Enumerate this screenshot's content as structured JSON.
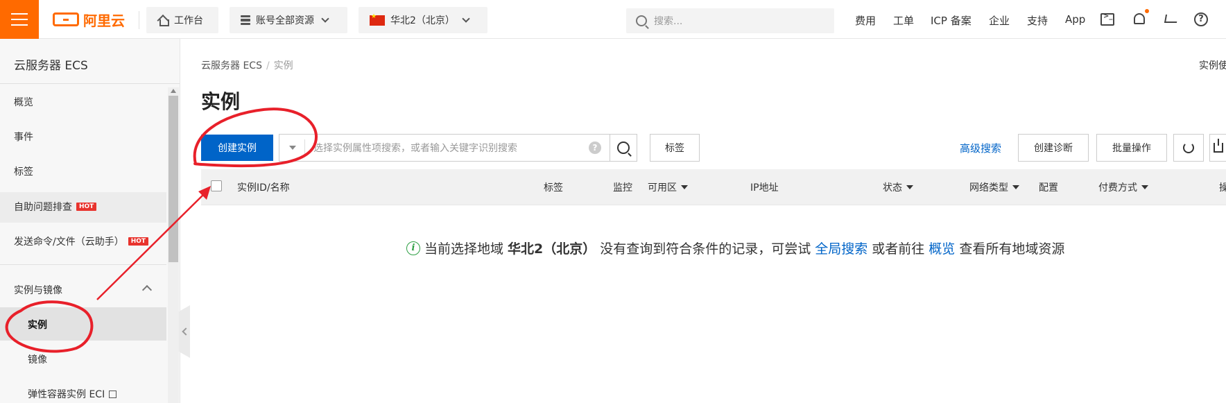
{
  "topbar": {
    "logo_text": "阿里云",
    "workbench": "工作台",
    "resources": "账号全部资源",
    "region": "华北2（北京）",
    "search_placeholder": "搜索...",
    "links": [
      "费用",
      "工单",
      "ICP 备案",
      "企业",
      "支持",
      "App"
    ],
    "help_glyph": "?"
  },
  "sidebar": {
    "title": "云服务器 ECS",
    "items": [
      {
        "label": "概览"
      },
      {
        "label": "事件"
      },
      {
        "label": "标签"
      },
      {
        "label": "自助问题排查",
        "badge": "HOT"
      },
      {
        "label": "发送命令/文件（云助手）",
        "badge": "HOT"
      }
    ],
    "group": {
      "label": "实例与镜像",
      "children": [
        "实例",
        "镜像",
        "弹性容器实例 ECI"
      ]
    }
  },
  "main": {
    "breadcrumb": [
      "云服务器 ECS",
      "实例"
    ],
    "right_cut_text": "实例使",
    "title": "实例",
    "create_button": "创建实例",
    "filter_placeholder": "选择实例属性项搜索，或者输入关键字识别搜索",
    "filter_help": "?",
    "tag_button": "标签",
    "advanced_search": "高级搜索",
    "diagnose_button": "创建诊断",
    "batch_button": "批量操作",
    "columns": [
      "实例ID/名称",
      "标签",
      "监控",
      "可用区",
      "IP地址",
      "状态",
      "网络类型",
      "配置",
      "付费方式",
      "操"
    ],
    "empty": {
      "info_glyph": "i",
      "prefix": "当前选择地域",
      "region": "华北2（北京）",
      "middle": "没有查询到符合条件的记录，可尝试",
      "link1": "全局搜索",
      "or": "或者前往",
      "link2": "概览",
      "suffix": "查看所有地域资源"
    }
  },
  "colors": {
    "brand_orange": "#ff6a00",
    "primary_blue": "#0064c8",
    "annotation_red": "#e8202a",
    "hot_red": "#e8332d",
    "info_green": "#2e9f44"
  }
}
